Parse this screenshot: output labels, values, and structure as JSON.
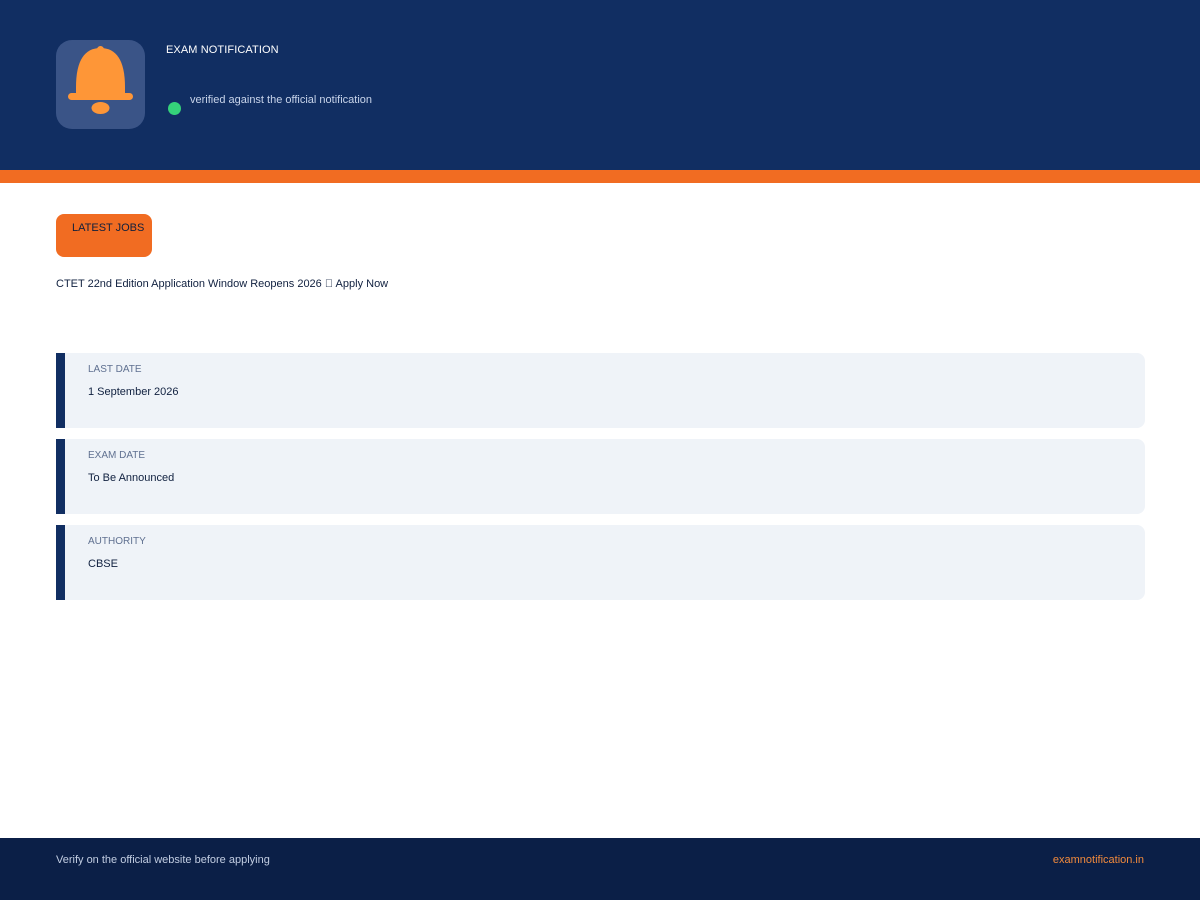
{
  "header": {
    "icon": "bell-icon",
    "title": "EXAM NOTIFICATION",
    "status_text": "verified against the official notification",
    "colors": {
      "background": "#112e62",
      "accent": "#f16c22",
      "bell": "#fe9637",
      "status_dot": "#35d27a"
    }
  },
  "main": {
    "tag_label": "LATEST JOBS",
    "headline": "CTET 22nd Edition Application Window Reopens 2026 \u0000 Apply Now",
    "cards": [
      {
        "label": "LAST DATE",
        "value": "1 September 2026"
      },
      {
        "label": "EXAM DATE",
        "value": "To Be Announced"
      },
      {
        "label": "AUTHORITY",
        "value": "CBSE"
      }
    ]
  },
  "footer": {
    "note": "Verify on the official website before applying",
    "site": "examnotification.in"
  }
}
